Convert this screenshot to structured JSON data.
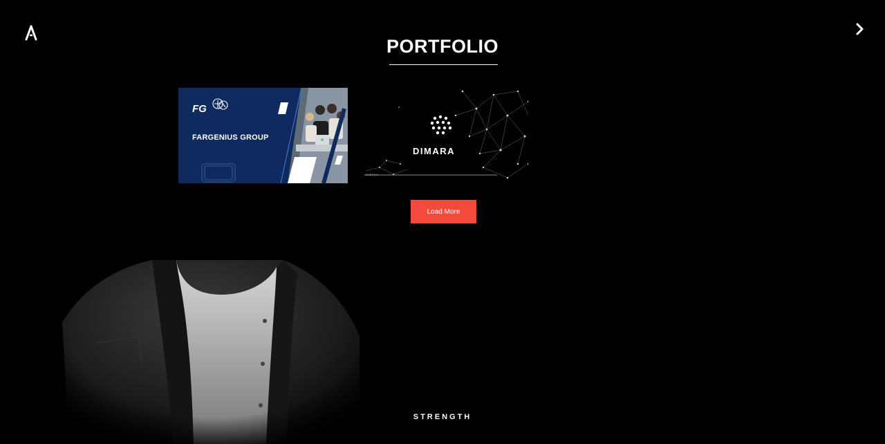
{
  "nav": {
    "logo_icon": "a-logo-icon",
    "next_icon": "chevron-right-icon"
  },
  "portfolio": {
    "title": "PORTFOLIO",
    "items": [
      {
        "fg_mark": "FG",
        "label": "FARGENIUS GROUP",
        "brand_color": "#0f2a5f"
      },
      {
        "label": "DIMARA",
        "small_label": "DIMARA"
      }
    ],
    "load_more_label": "Load More",
    "load_more_color": "#f24b3c"
  },
  "hero": {
    "caption": "STRENGTH"
  }
}
